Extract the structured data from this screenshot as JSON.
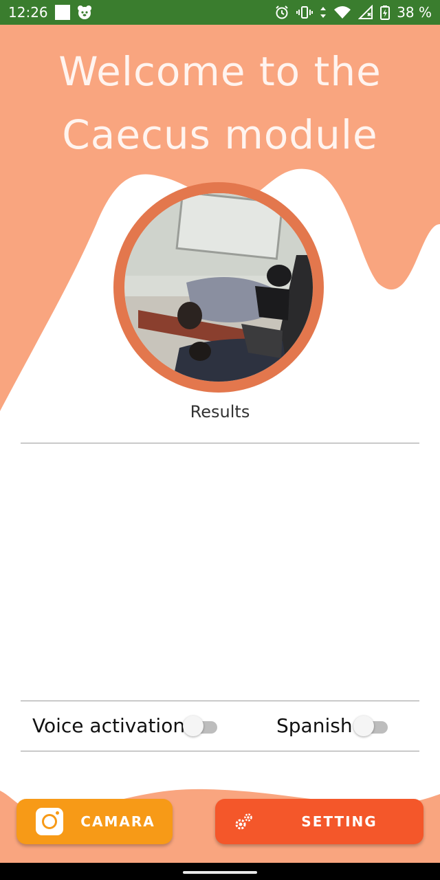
{
  "status_bar": {
    "time": "12:26",
    "battery": "38 %",
    "background": "#3a7d2e"
  },
  "header": {
    "title_line1": "Welcome to the",
    "title_line2": "Caecus module"
  },
  "main": {
    "results_label": "Results"
  },
  "toggles": {
    "voice_label": "Voice activation",
    "voice_on": false,
    "spanish_label": "Spanish",
    "spanish_on": false
  },
  "buttons": {
    "camera_label": "CAMARA",
    "setting_label": "SETTING"
  },
  "colors": {
    "header_shape": "#f9a57f",
    "photo_ring": "#e3774d",
    "camera_button": "#f79a17",
    "setting_button": "#f4572a"
  },
  "icons": {
    "status_left": [
      "square-notification-icon",
      "bear-app-icon"
    ],
    "status_right": [
      "alarm-icon",
      "vibrate-icon",
      "data-arrows-icon",
      "wifi-icon",
      "signal-icon",
      "battery-icon"
    ],
    "camera": "camera-icon",
    "setting": "gears-icon"
  }
}
